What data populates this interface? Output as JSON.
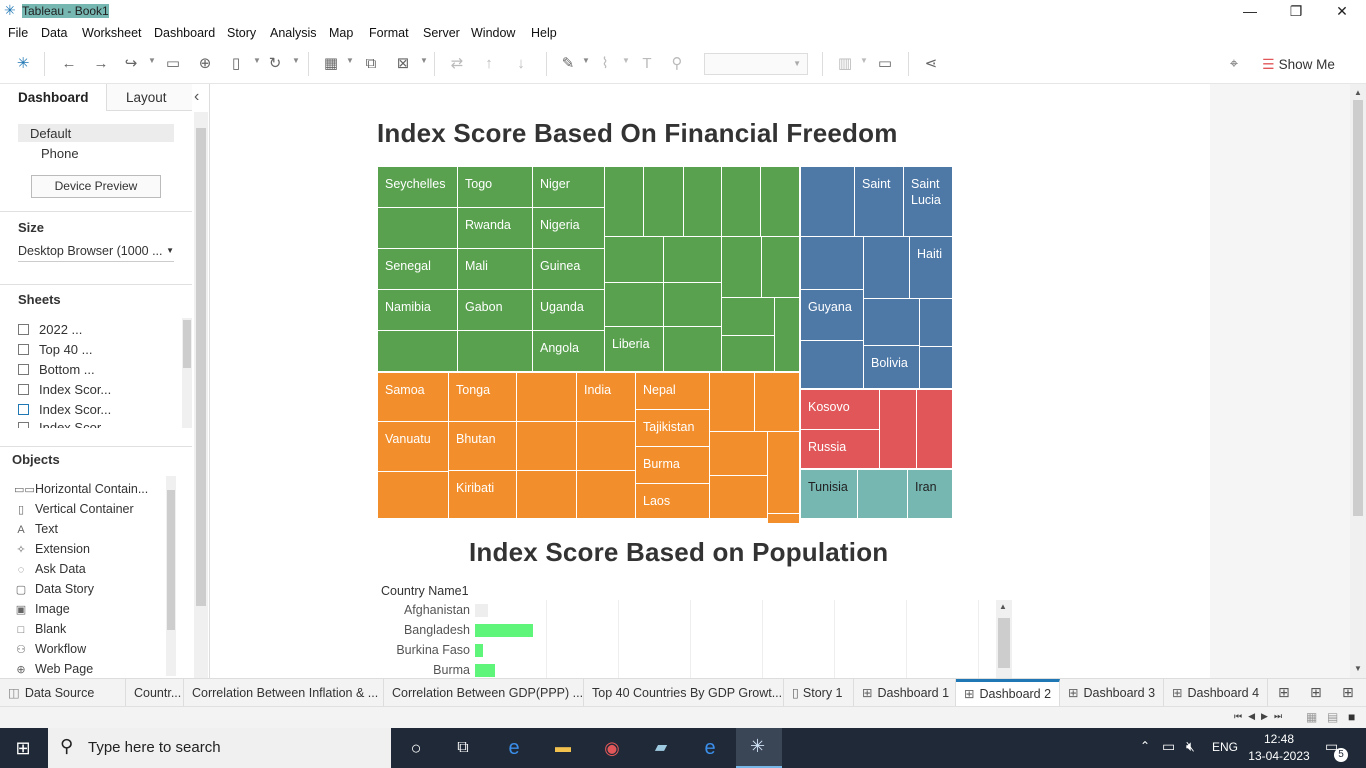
{
  "window": {
    "title": "Tableau - Book1",
    "minimize": "—",
    "restore": "❐",
    "close": "✕"
  },
  "menu": [
    "File",
    "Data",
    "Worksheet",
    "Dashboard",
    "Story",
    "Analysis",
    "Map",
    "Format",
    "Server",
    "Window",
    "Help"
  ],
  "toolbar": {
    "show_me": "Show Me"
  },
  "left_panel": {
    "tab_dashboard": "Dashboard",
    "tab_layout": "Layout",
    "collapse": "‹",
    "devices": [
      "Default",
      "Phone"
    ],
    "device_preview": "Device Preview",
    "size_title": "Size",
    "size_value": "Desktop Browser (1000 ...",
    "sheets_title": "Sheets",
    "sheets": [
      "2022 ...",
      "Top 40 ...",
      "Bottom ...",
      "Index Scor...",
      "Index Scor...",
      "Index Scor..."
    ],
    "objects_title": "Objects",
    "objects": [
      {
        "label": "Horizontal Contain...",
        "icon": "horizontal-container-icon",
        "glyph": "▭▭"
      },
      {
        "label": "Vertical Container",
        "icon": "vertical-container-icon",
        "glyph": "▯"
      },
      {
        "label": "Text",
        "icon": "text-icon",
        "glyph": "A"
      },
      {
        "label": "Extension",
        "icon": "extension-icon",
        "glyph": "✧"
      },
      {
        "label": "Ask Data",
        "icon": "ask-data-icon",
        "glyph": "◌"
      },
      {
        "label": "Data Story",
        "icon": "data-story-icon",
        "glyph": "▢"
      },
      {
        "label": "Image",
        "icon": "image-icon",
        "glyph": "▣"
      },
      {
        "label": "Blank",
        "icon": "blank-icon",
        "glyph": "□"
      },
      {
        "label": "Workflow",
        "icon": "workflow-icon",
        "glyph": "⚇"
      },
      {
        "label": "Web Page",
        "icon": "web-page-icon",
        "glyph": "⊕"
      }
    ]
  },
  "dashboard": {
    "treemap_title": "Index Score Based On Financial Freedom",
    "treemap_labels": {
      "seychelles": "Seychelles",
      "togo": "Togo",
      "niger": "Niger",
      "rwanda": "Rwanda",
      "nigeria": "Nigeria",
      "senegal": "Senegal",
      "mali": "Mali",
      "guinea": "Guinea",
      "namibia": "Namibia",
      "gabon": "Gabon",
      "uganda": "Uganda",
      "angola": "Angola",
      "liberia": "Liberia",
      "saint": "Saint",
      "saint_lucia": "Saint Lucia",
      "haiti": "Haiti",
      "guyana": "Guyana",
      "bolivia": "Bolivia",
      "samoa": "Samoa",
      "tonga": "Tonga",
      "india": "India",
      "nepal": "Nepal",
      "vanuatu": "Vanuatu",
      "bhutan": "Bhutan",
      "tajikistan": "Tajikistan",
      "burma": "Burma",
      "kiribati": "Kiribati",
      "laos": "Laos",
      "kosovo": "Kosovo",
      "russia": "Russia",
      "tunisia": "Tunisia",
      "iran": "Iran"
    },
    "bar_title": "Index Score Based on Population",
    "bar_header": "Country Name1",
    "bar_rows": [
      {
        "country": "Afghanistan",
        "value": 0.05
      },
      {
        "country": "Bangladesh",
        "value": 0.23
      },
      {
        "country": "Burkina Faso",
        "value": 0.03
      },
      {
        "country": "Burma",
        "value": 0.08
      }
    ]
  },
  "tabs": [
    {
      "label": "Data Source",
      "icon": "database-icon"
    },
    {
      "label": "Countr...",
      "icon": ""
    },
    {
      "label": "Correlation Between Inflation & ...",
      "icon": ""
    },
    {
      "label": "Correlation Between GDP(PPP) ...",
      "icon": ""
    },
    {
      "label": "Top 40 Countries By GDP Growt...",
      "icon": ""
    },
    {
      "label": "Story 1",
      "icon": "story-icon"
    },
    {
      "label": "Dashboard 1",
      "icon": "dashboard-icon"
    },
    {
      "label": "Dashboard 2",
      "icon": "dashboard-icon"
    },
    {
      "label": "Dashboard 3",
      "icon": "dashboard-icon"
    },
    {
      "label": "Dashboard 4",
      "icon": "dashboard-icon"
    }
  ],
  "taskbar": {
    "search_placeholder": "Type here to search",
    "language": "ENG",
    "time": "12:48",
    "date": "13-04-2023",
    "notifications": "5"
  }
}
